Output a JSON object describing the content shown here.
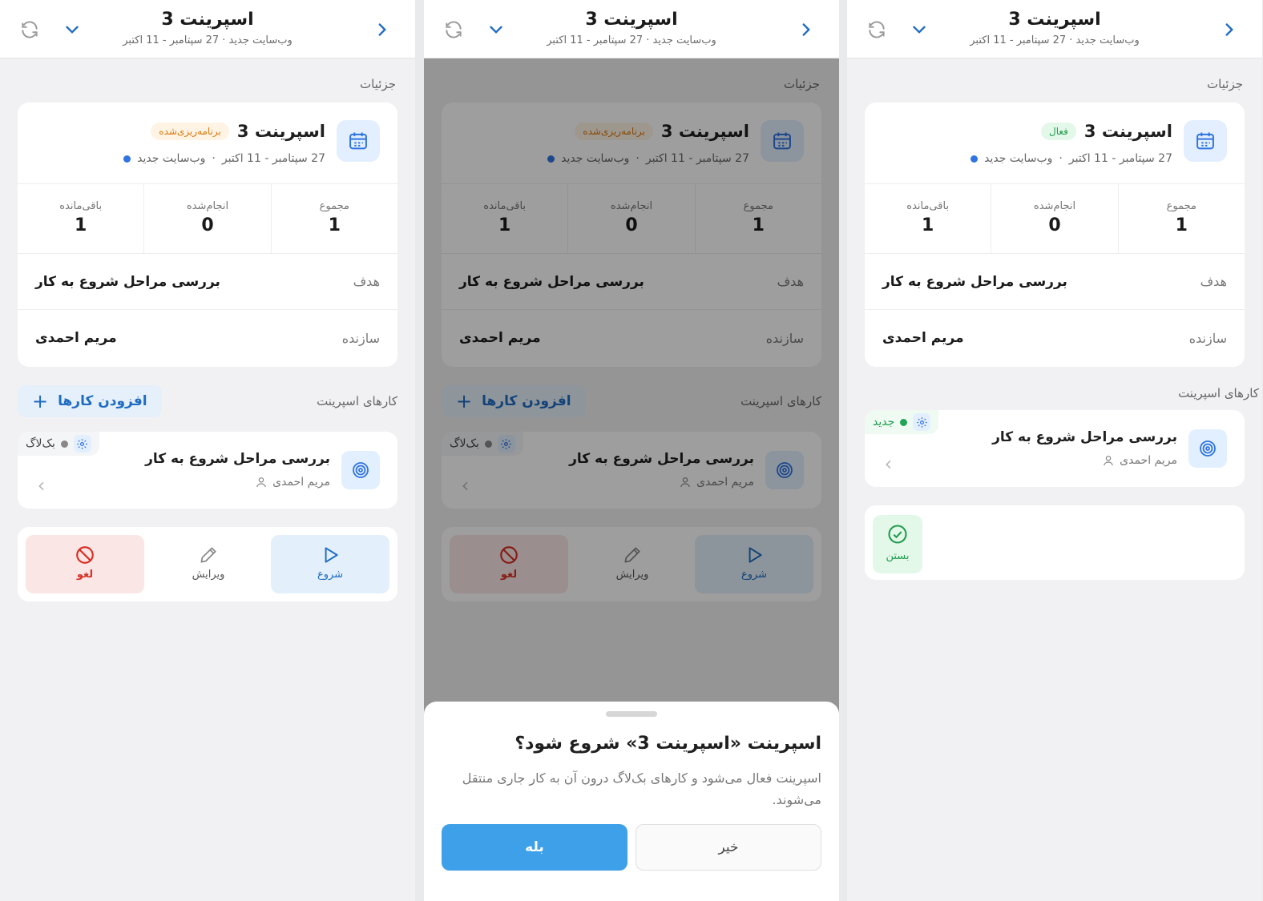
{
  "header": {
    "title": "اسپرینت 3",
    "subtitle": "وب‌سایت جدید · 27 سپتامبر - 11 اکتبر"
  },
  "details_label": "جزئیات",
  "summary": {
    "title": "اسپرینت 3",
    "project": "وب‌سایت جدید",
    "dates": "27 سپتامبر - 11 اکتبر",
    "separator": "·",
    "status_planned": "برنامه‌ریزی‌شده",
    "status_active": "فعال",
    "stats": [
      {
        "label": "مجموع",
        "value": "1"
      },
      {
        "label": "انجام‌شده",
        "value": "0"
      },
      {
        "label": "باقی‌مانده",
        "value": "1"
      }
    ],
    "goal_label": "هدف",
    "goal_value": "بررسی مراحل شروع به کار",
    "creator_label": "سازنده",
    "creator_value": "مریم احمدی"
  },
  "tasks": {
    "label": "کارهای اسپرینت",
    "add_button": "افزودن کارها",
    "plus": "+",
    "item": {
      "title": "بررسی مراحل شروع به کار",
      "assignee": "مریم احمدی",
      "status_backlog": "بک‌لاگ",
      "status_new": "جدید"
    }
  },
  "actions": {
    "start": "شروع",
    "edit": "ویرایش",
    "cancel": "لغو",
    "close": "بستن"
  },
  "dialog": {
    "title": "اسپرینت «اسپرینت 3» شروع شود؟",
    "description": "اسپرینت فعال می‌شود و کارهای بک‌لاگ درون آن به کار جاری منتقل می‌شوند.",
    "yes": "بله",
    "no": "خیر"
  },
  "colors": {
    "accent": "#1f6cc2",
    "primary_button": "#3da0e8",
    "planned": "#d9770f",
    "active": "#1e9d4c",
    "danger": "#d93025"
  },
  "icons": [
    "refresh-icon",
    "chevron-down-icon",
    "chevron-right-icon",
    "calendar-icon",
    "target-icon",
    "user-icon",
    "gear-icon",
    "chevron-left-icon",
    "play-icon",
    "pencil-icon",
    "ban-icon",
    "check-circle-icon"
  ]
}
